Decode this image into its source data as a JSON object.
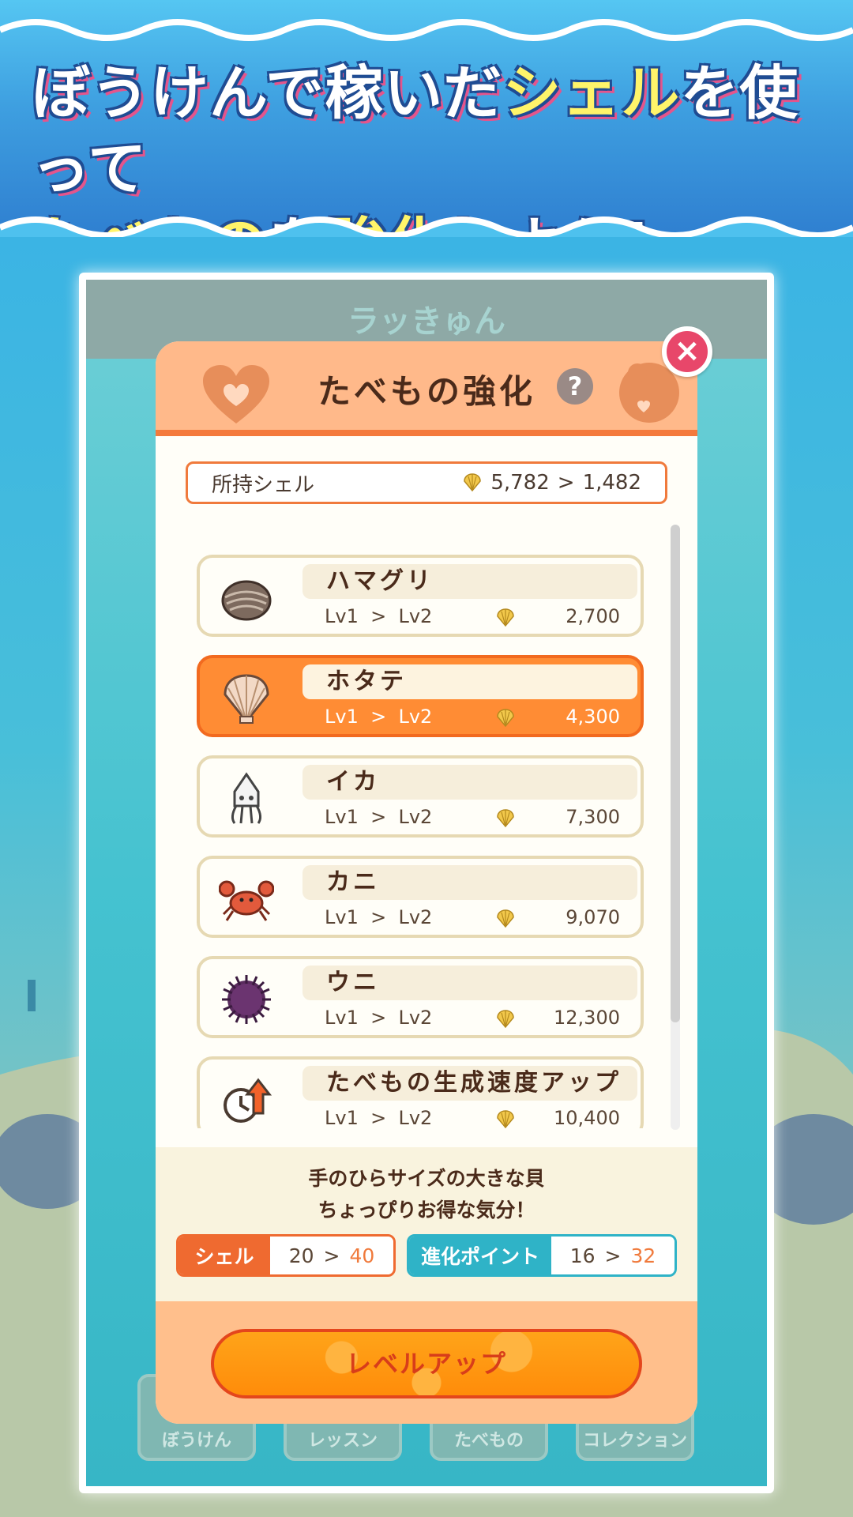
{
  "banner": {
    "line1_part1": "ぼうけんで稼いだ",
    "line1_highlight": "シェル",
    "line1_part2": "を使って",
    "line2_highlight1": "たべもの",
    "line2_part1": "を",
    "line2_highlight2": "強化",
    "line2_part2": "しよう!"
  },
  "background_app": {
    "title": "ラッきゅん",
    "nav": [
      "ぼうけん",
      "レッスン",
      "たべもの",
      "コレクション"
    ]
  },
  "modal": {
    "title": "たべもの強化",
    "help_label": "?",
    "close_label": "×",
    "owned_shell": {
      "label": "所持シェル",
      "current": "5,782",
      "arrow": ">",
      "after": "1,482"
    },
    "items": [
      {
        "name": "ハマグリ",
        "from": "Lv1",
        "to": "Lv2",
        "cost": "2,700",
        "icon": "clam-icon",
        "selected": false
      },
      {
        "name": "ホタテ",
        "from": "Lv1",
        "to": "Lv2",
        "cost": "4,300",
        "icon": "scallop-icon",
        "selected": true
      },
      {
        "name": "イカ",
        "from": "Lv1",
        "to": "Lv2",
        "cost": "7,300",
        "icon": "squid-icon",
        "selected": false
      },
      {
        "name": "カニ",
        "from": "Lv1",
        "to": "Lv2",
        "cost": "9,070",
        "icon": "crab-icon",
        "selected": false
      },
      {
        "name": "ウニ",
        "from": "Lv1",
        "to": "Lv2",
        "cost": "12,300",
        "icon": "urchin-icon",
        "selected": false
      },
      {
        "name": "たべもの生成速度アップ",
        "from": "Lv1",
        "to": "Lv2",
        "cost": "10,400",
        "icon": "speed-up-icon",
        "selected": false
      }
    ],
    "description_line1": "手のひらサイズの大きな貝",
    "description_line2": "ちょっぴりお得な気分！",
    "stats": {
      "shell": {
        "label": "シェル",
        "from": "20",
        "to": "40"
      },
      "evolution": {
        "label": "進化ポイント",
        "from": "16",
        "to": "32"
      }
    },
    "level_up_label": "レベルアップ",
    "arrow": ">"
  },
  "colors": {
    "accent_orange": "#f07a3c",
    "selected_orange": "#ff8c34",
    "close_pink": "#e8476a",
    "teal": "#2fb3c7"
  }
}
